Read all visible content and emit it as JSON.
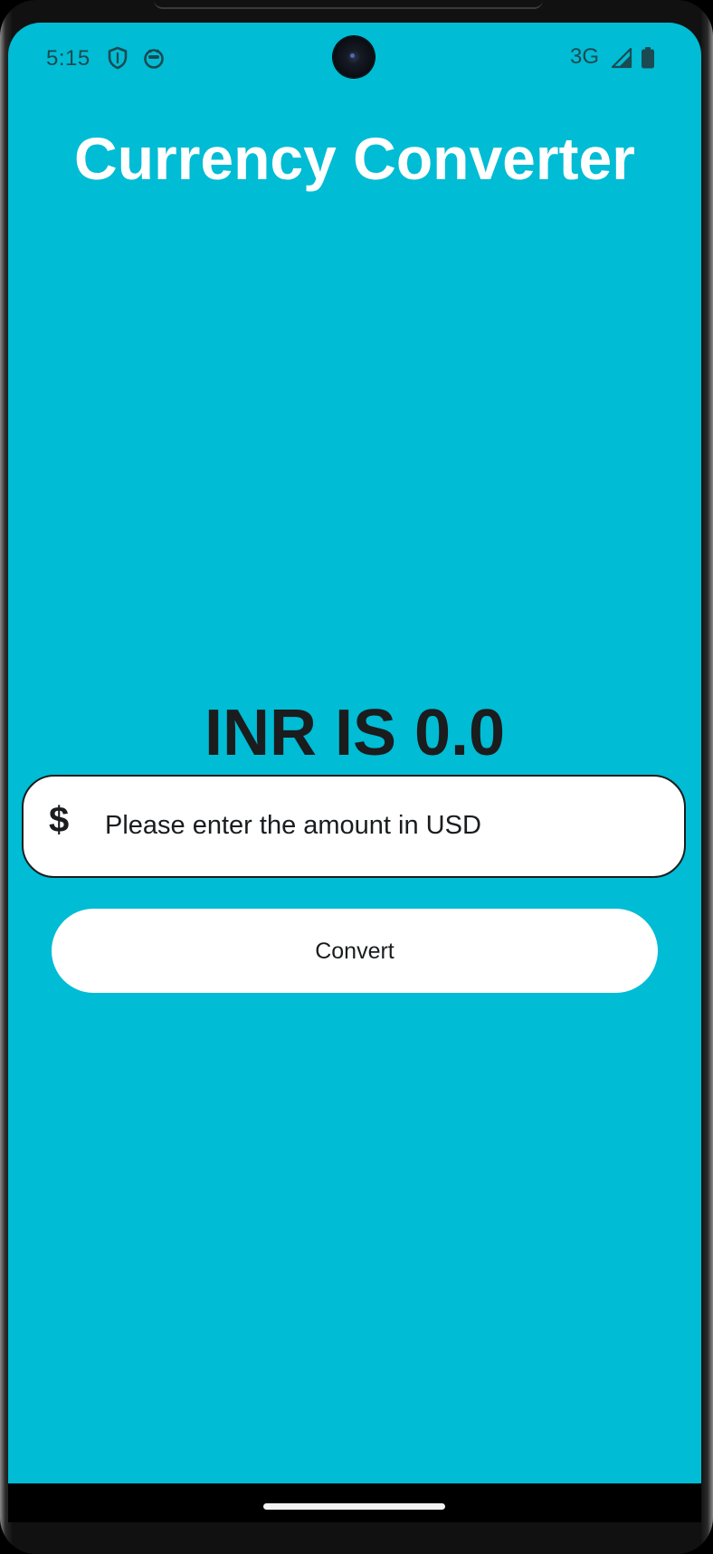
{
  "status_bar": {
    "time": "5:15",
    "network": "3G",
    "icons": [
      "shield-icon",
      "robot-face-icon",
      "signal-icon",
      "battery-icon"
    ]
  },
  "app": {
    "title": "Currency Converter",
    "result_text": "INR IS 0.0",
    "amount_field": {
      "icon": "dollar-icon",
      "icon_glyph": "$",
      "placeholder": "Please enter the amount in USD",
      "value": ""
    },
    "convert_button_label": "Convert"
  },
  "colors": {
    "background": "#00bcd4",
    "title": "#ffffff",
    "text": "#1a1c1e",
    "surface": "#ffffff"
  }
}
